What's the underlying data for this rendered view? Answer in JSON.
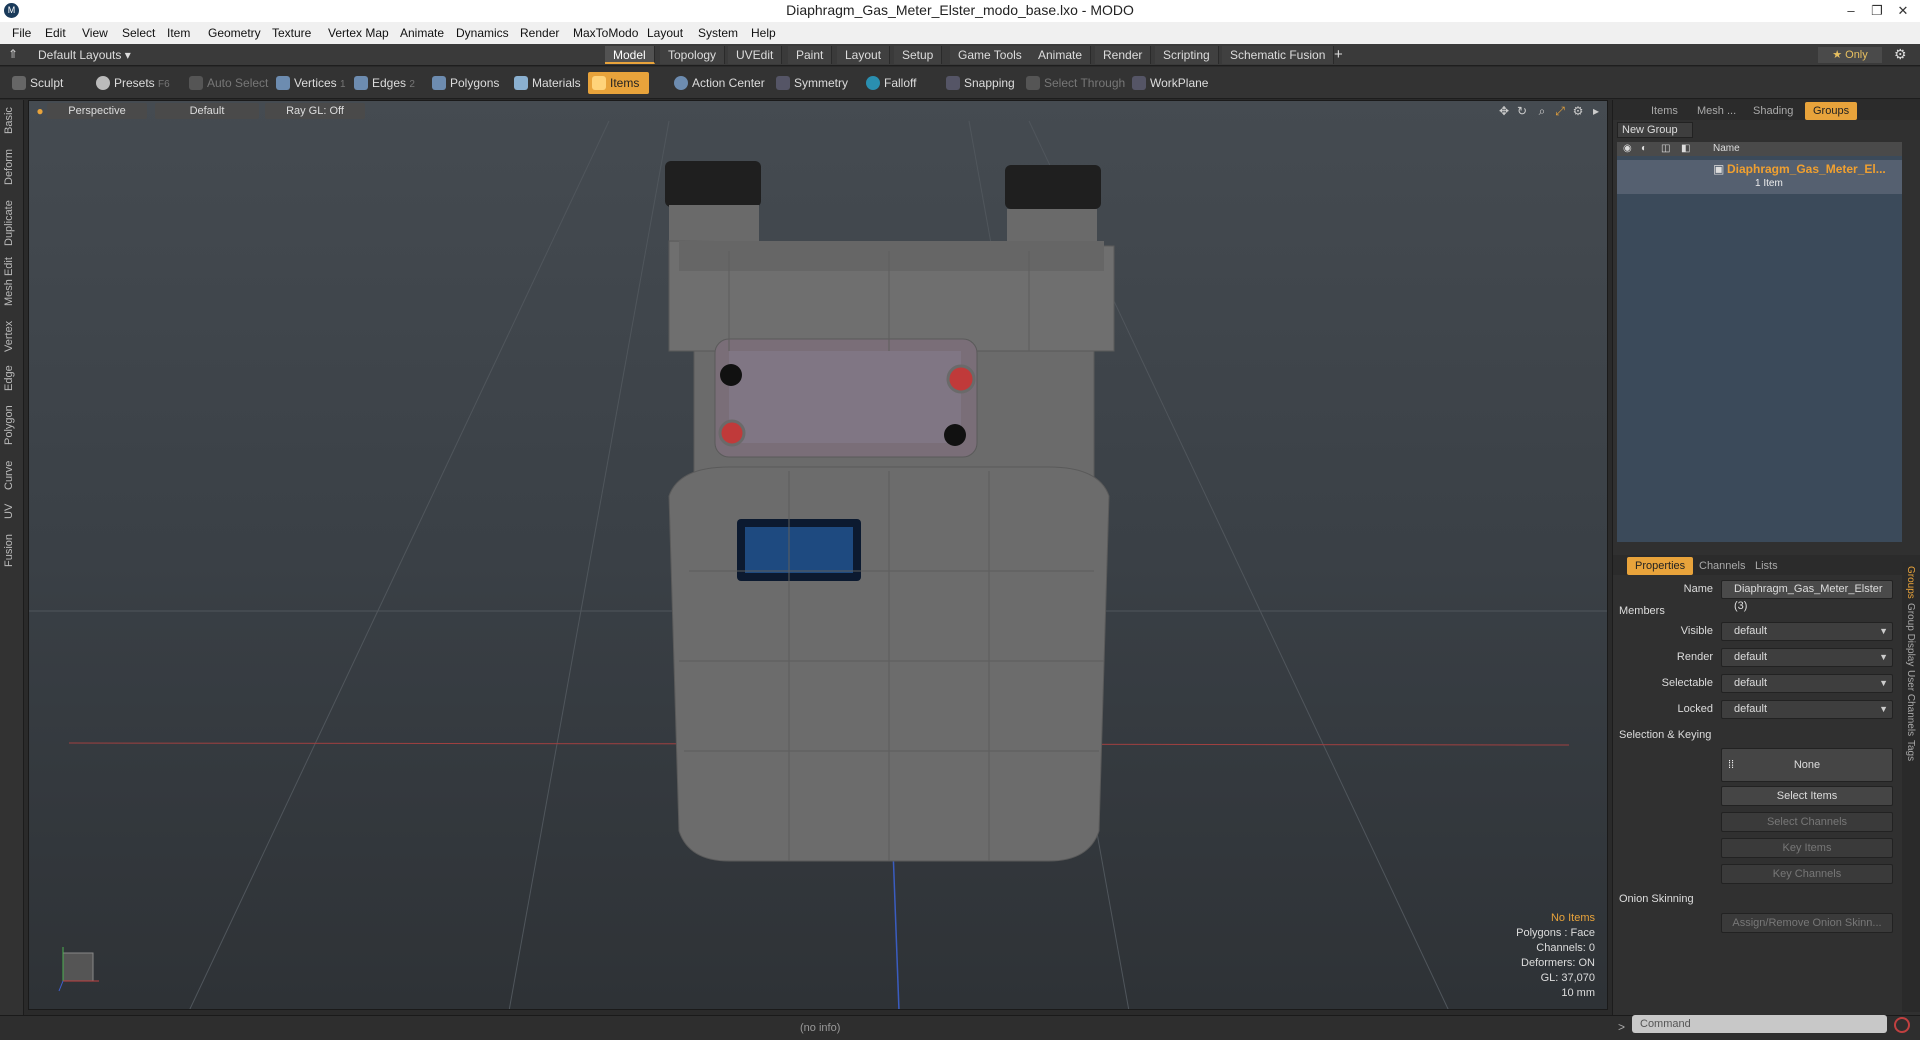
{
  "window": {
    "title": "Diaphragm_Gas_Meter_Elster_modo_base.lxo - MODO",
    "logo": "M"
  },
  "menu": [
    "File",
    "Edit",
    "View",
    "Select",
    "Item",
    "Geometry",
    "Texture",
    "Vertex Map",
    "Animate",
    "Dynamics",
    "Render",
    "MaxToModo",
    "Layout",
    "System",
    "Help"
  ],
  "layout": {
    "preset": "Default Layouts ▾",
    "tabs": [
      "Model",
      "Topology",
      "UVEdit",
      "Paint",
      "Layout",
      "Setup",
      "Game Tools",
      "Animate",
      "Render",
      "Scripting",
      "Schematic Fusion"
    ],
    "active_tab": "Model",
    "add_tab": "+",
    "only": "★ Only"
  },
  "toolbar": {
    "sculpt": "Sculpt",
    "presets": "Presets",
    "presets_key": "F6",
    "auto_select": "Auto Select",
    "vertices": "Vertices",
    "vertices_n": "1",
    "edges": "Edges",
    "edges_n": "2",
    "polygons": "Polygons",
    "materials": "Materials",
    "items": "Items",
    "action_center": "Action Center",
    "symmetry": "Symmetry",
    "falloff": "Falloff",
    "snapping": "Snapping",
    "select_through": "Select Through",
    "workplane": "WorkPlane"
  },
  "left_tabs": [
    "Basic",
    "Deform",
    "Duplicate",
    "Mesh Edit",
    "Vertex",
    "Edge",
    "Polygon",
    "Curve",
    "UV",
    "Fusion"
  ],
  "viewport": {
    "view": "Perspective",
    "shading": "Default",
    "raygl": "Ray GL: Off",
    "hud": {
      "no_items": "No Items",
      "polygons": "Polygons : Face",
      "channels": "Channels: 0",
      "deformers": "Deformers: ON",
      "gl": "GL: 37,070",
      "scale": "10 mm"
    }
  },
  "status": {
    "info": "(no info)",
    "command_placeholder": "Command"
  },
  "groups_panel": {
    "tabs": [
      "Items",
      "Mesh ...",
      "Shading",
      "Groups"
    ],
    "active": "Groups",
    "new_group": "New Group",
    "col_name": "Name",
    "group_name": "Diaphragm_Gas_Meter_El...",
    "group_sub": "1 Item"
  },
  "properties": {
    "tabs": [
      "Properties",
      "Channels",
      "Lists"
    ],
    "name_label": "Name",
    "name_value": "Diaphragm_Gas_Meter_Elster (3)",
    "members": "Members",
    "visible_label": "Visible",
    "visible": "default",
    "render_label": "Render",
    "render": "default",
    "selectable_label": "Selectable",
    "selectable": "default",
    "locked_label": "Locked",
    "locked": "default",
    "selection_keying": "Selection & Keying",
    "none": "None",
    "select_items": "Select Items",
    "select_channels": "Select Channels",
    "key_items": "Key Items",
    "key_channels": "Key Channels",
    "onion": "Onion Skinning",
    "assign_onion": "Assign/Remove Onion Skinn..."
  },
  "right_vtabs": [
    "Groups",
    "Group Display",
    "User Channels",
    "Tags"
  ],
  "colors": {
    "accent": "#e8a33b",
    "bg": "#2a2a2a"
  }
}
